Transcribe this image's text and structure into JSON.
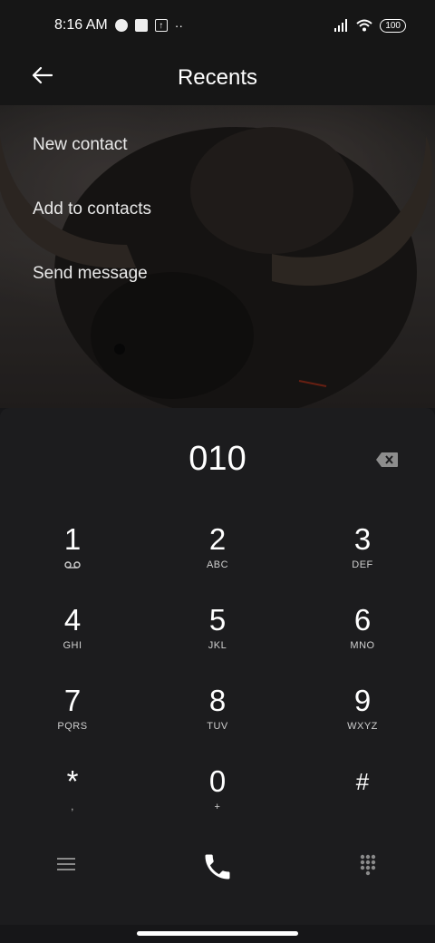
{
  "status_bar": {
    "time": "8:16 AM",
    "battery": "100"
  },
  "header": {
    "title": "Recents"
  },
  "menu": {
    "items": [
      {
        "label": "New contact"
      },
      {
        "label": "Add to contacts"
      },
      {
        "label": "Send message"
      }
    ]
  },
  "dialer": {
    "number": "010",
    "keys": [
      {
        "digit": "1",
        "letters": ""
      },
      {
        "digit": "2",
        "letters": "ABC"
      },
      {
        "digit": "3",
        "letters": "DEF"
      },
      {
        "digit": "4",
        "letters": "GHI"
      },
      {
        "digit": "5",
        "letters": "JKL"
      },
      {
        "digit": "6",
        "letters": "MNO"
      },
      {
        "digit": "7",
        "letters": "PQRS"
      },
      {
        "digit": "8",
        "letters": "TUV"
      },
      {
        "digit": "9",
        "letters": "WXYZ"
      },
      {
        "digit": "*",
        "letters": ","
      },
      {
        "digit": "0",
        "letters": "+"
      },
      {
        "digit": "#",
        "letters": ""
      }
    ]
  },
  "icons": {
    "voicemail": "voicemail-icon",
    "menu": "menu-icon",
    "call": "call-icon",
    "keypad": "keypad-icon",
    "backspace": "backspace-icon"
  }
}
